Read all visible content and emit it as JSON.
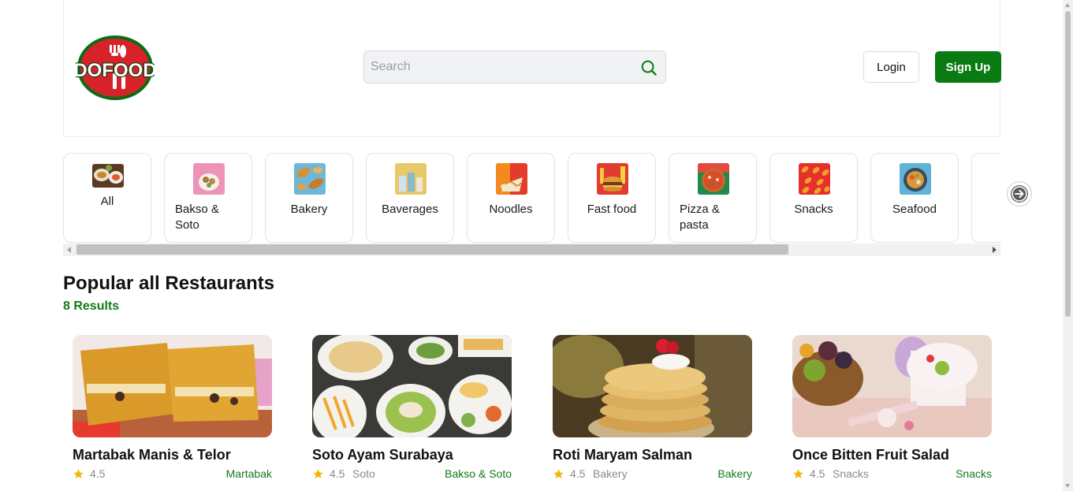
{
  "header": {
    "logo_text": "DOFOOD",
    "search_placeholder": "Search",
    "login_label": "Login",
    "signup_label": "Sign Up"
  },
  "categories": [
    {
      "label": "All",
      "icon": "all-food-icon"
    },
    {
      "label": "Bakso & Soto",
      "icon": "bakso-soto-icon"
    },
    {
      "label": "Bakery",
      "icon": "bakery-icon"
    },
    {
      "label": "Baverages",
      "icon": "beverages-icon"
    },
    {
      "label": "Noodles",
      "icon": "noodles-icon"
    },
    {
      "label": "Fast food",
      "icon": "fast-food-icon"
    },
    {
      "label": "Pizza & pasta",
      "icon": "pizza-pasta-icon"
    },
    {
      "label": "Snacks",
      "icon": "snacks-icon"
    },
    {
      "label": "Seafood",
      "icon": "seafood-icon"
    }
  ],
  "section": {
    "title": "Popular all Restaurants",
    "count": "8 Results"
  },
  "restaurants": [
    {
      "name": "Martabak Manis & Telor",
      "rating": "4.5",
      "subcategory": "",
      "category": "Martabak"
    },
    {
      "name": "Soto Ayam Surabaya",
      "rating": "4.5",
      "subcategory": "Soto",
      "category": "Bakso & Soto"
    },
    {
      "name": "Roti Maryam Salman",
      "rating": "4.5",
      "subcategory": "Bakery",
      "category": "Bakery"
    },
    {
      "name": "Once Bitten Fruit Salad",
      "rating": "4.5",
      "subcategory": "Snacks",
      "category": "Snacks"
    }
  ],
  "colors": {
    "brand_green": "#0a7a12",
    "accent_text_green": "#137a1a",
    "logo_red": "#d8222a",
    "star": "#f4b400"
  }
}
